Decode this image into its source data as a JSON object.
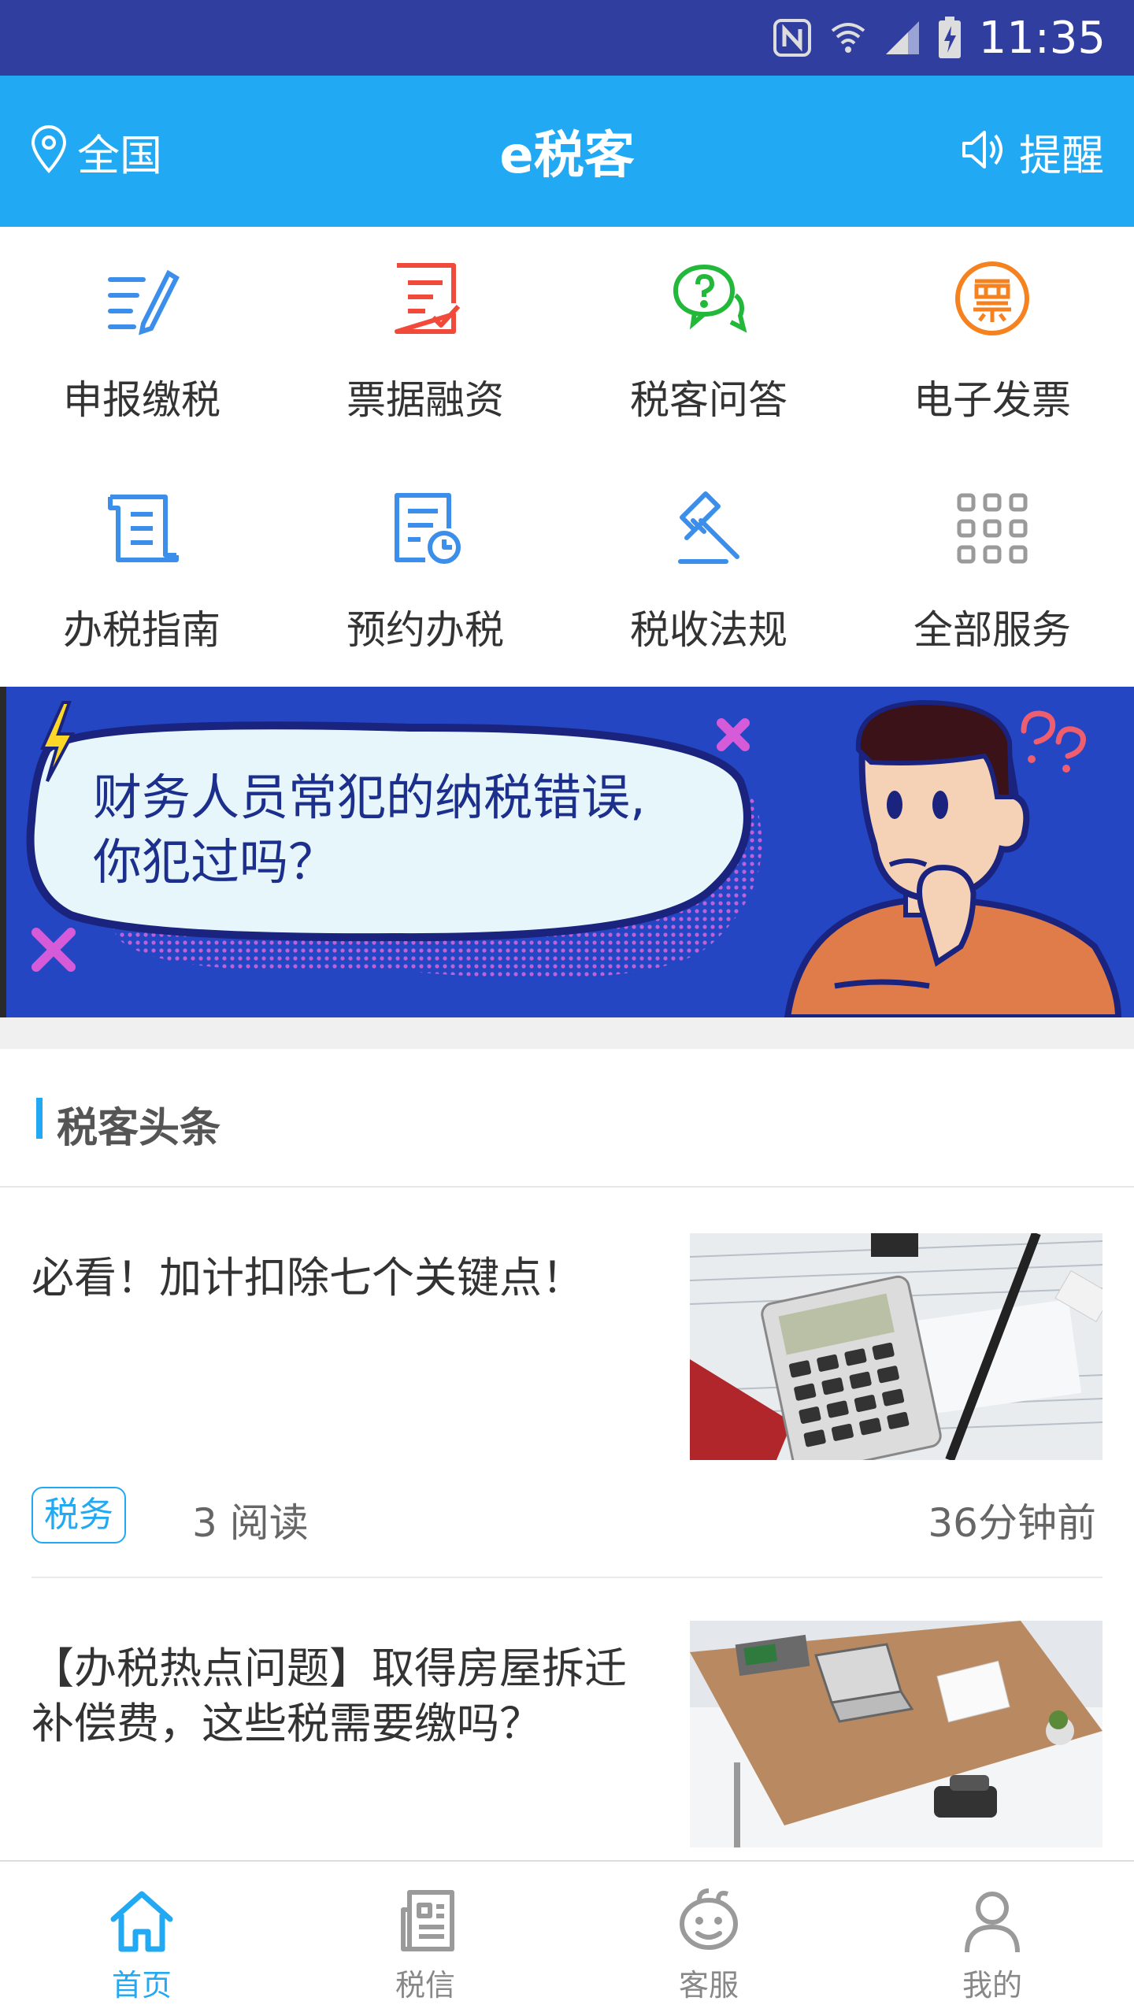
{
  "status_bar": {
    "time": "11:35",
    "icons": [
      "nfc-icon",
      "wifi-icon",
      "signal-icon",
      "battery-charging-icon"
    ]
  },
  "header": {
    "location": "全国",
    "title": "e税客",
    "remind": "提醒"
  },
  "services": [
    {
      "label": "申报缴税",
      "icon": "edit-list-icon",
      "color": "#3B8EEA"
    },
    {
      "label": "票据融资",
      "icon": "invoice-check-icon",
      "color": "#F24A3A"
    },
    {
      "label": "税客问答",
      "icon": "question-chat-icon",
      "color": "#22B83A"
    },
    {
      "label": "电子发票",
      "icon": "e-invoice-icon",
      "color": "#F5821F"
    },
    {
      "label": "办税指南",
      "icon": "guide-scroll-icon",
      "color": "#3B8EEA"
    },
    {
      "label": "预约办税",
      "icon": "appointment-clock-icon",
      "color": "#3B8EEA"
    },
    {
      "label": "税收法规",
      "icon": "gavel-icon",
      "color": "#3B8EEA"
    },
    {
      "label": "全部服务",
      "icon": "grid-icon",
      "color": "#9A9A9A"
    }
  ],
  "banner": {
    "line1": "财务人员常犯的纳税错误,",
    "line2": "你犯过吗？"
  },
  "section": {
    "title": "税客头条"
  },
  "news": [
    {
      "title": "必看！加计扣除七个关键点！",
      "tag": "税务",
      "reads": "3 阅读",
      "time": "36分钟前",
      "thumb": "calculator-tax-forms-photo"
    },
    {
      "title": "【办税热点问题】取得房屋拆迁补偿费，这些税需要缴吗？",
      "thumb": "office-desk-photo"
    }
  ],
  "bottom_nav": [
    {
      "label": "首页",
      "icon": "home-icon",
      "active": true
    },
    {
      "label": "税信",
      "icon": "news-icon",
      "active": false
    },
    {
      "label": "客服",
      "icon": "robot-face-icon",
      "active": false
    },
    {
      "label": "我的",
      "icon": "person-icon",
      "active": false
    }
  ],
  "colors": {
    "status_bar": "#303F9F",
    "primary": "#22A9F4",
    "banner_bg": "#2546C3"
  }
}
